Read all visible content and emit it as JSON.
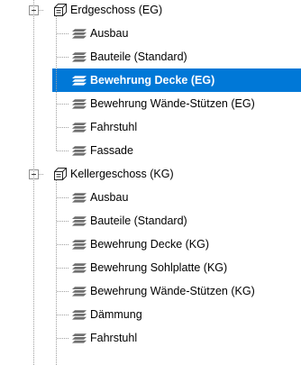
{
  "tree": {
    "groups": [
      {
        "label": "Erdgeschoss (EG)",
        "children": [
          {
            "label": "Ausbau"
          },
          {
            "label": "Bauteile (Standard)"
          },
          {
            "label": "Bewehrung Decke (EG)",
            "selected": true
          },
          {
            "label": "Bewehrung Wände-Stützen (EG)"
          },
          {
            "label": "Fahrstuhl"
          },
          {
            "label": "Fassade"
          }
        ]
      },
      {
        "label": "Kellergeschoss (KG)",
        "children": [
          {
            "label": "Ausbau"
          },
          {
            "label": "Bauteile (Standard)"
          },
          {
            "label": "Bewehrung Decke (KG)"
          },
          {
            "label": "Bewehrung Sohlplatte (KG)"
          },
          {
            "label": "Bewehrung Wände-Stützen (KG)"
          },
          {
            "label": "Dämmung"
          },
          {
            "label": "Fahrstuhl"
          }
        ]
      }
    ],
    "icons": {
      "group": "structure-folder-icon",
      "item": "layer-stack-icon",
      "toggle": "collapse-minus-icon"
    },
    "colors": {
      "selection": "#0078d7",
      "selection_text": "#ffffff",
      "guide_lines": "#a0a0a0"
    }
  }
}
